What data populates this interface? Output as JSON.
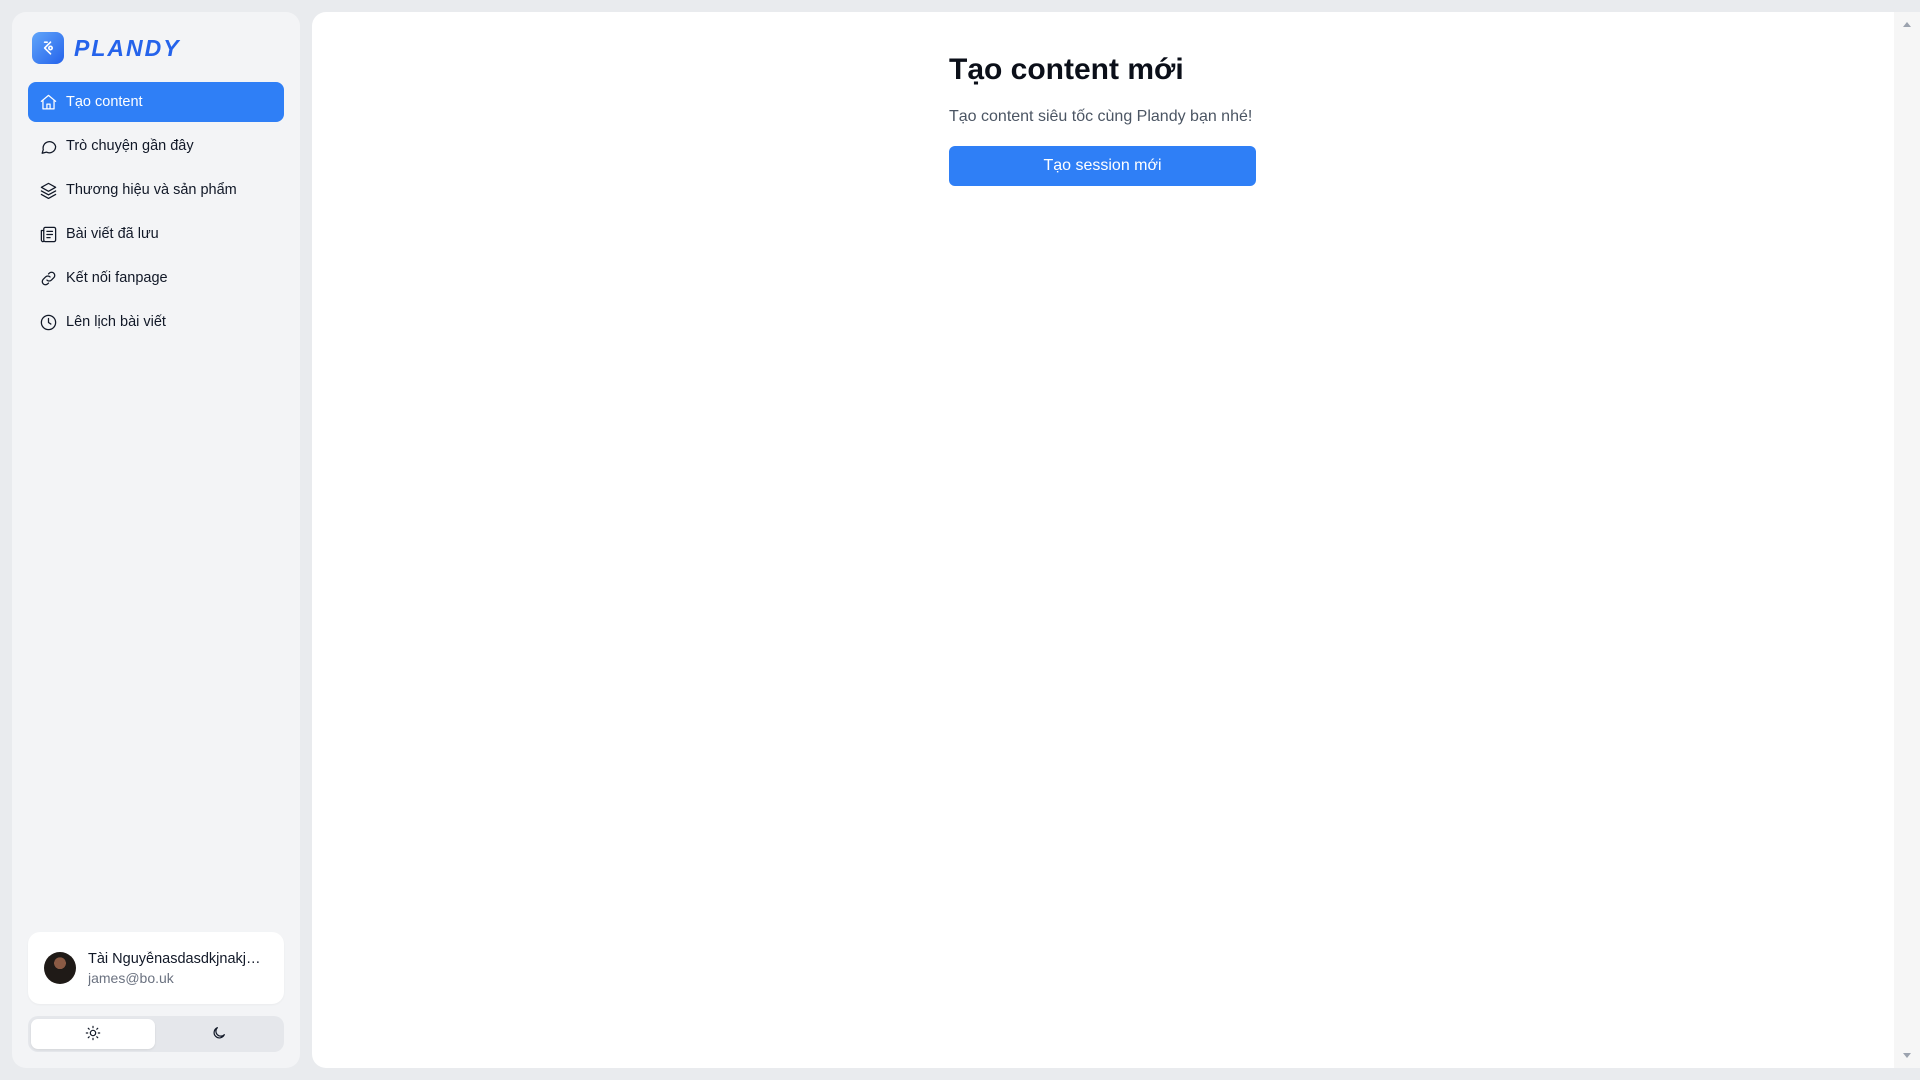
{
  "app": {
    "logo_text": "PLANDY",
    "accent_color": "#2f7ff6"
  },
  "sidebar": {
    "items": [
      {
        "label": "Tạo content",
        "icon": "home-icon",
        "active": true
      },
      {
        "label": "Trò chuyện gần đây",
        "icon": "chat-bubble-icon",
        "active": false
      },
      {
        "label": "Thương hiệu và sản phẩm",
        "icon": "layers-icon",
        "active": false
      },
      {
        "label": "Bài viết đã lưu",
        "icon": "newspaper-icon",
        "active": false
      },
      {
        "label": "Kết nối fanpage",
        "icon": "link-icon",
        "active": false
      },
      {
        "label": "Lên lịch bài viết",
        "icon": "clock-icon",
        "active": false
      }
    ]
  },
  "user": {
    "name": "Tài Nguyễnasdasdkjnakjdnaksjdn",
    "email": "james@bo.uk"
  },
  "theme": {
    "selected": "light",
    "options": [
      "sun-icon",
      "moon-icon"
    ]
  },
  "main": {
    "title": "Tạo content mới",
    "subtitle": "Tạo content siêu tốc cùng Plandy bạn nhé!",
    "cta_label": "Tạo session mới"
  }
}
